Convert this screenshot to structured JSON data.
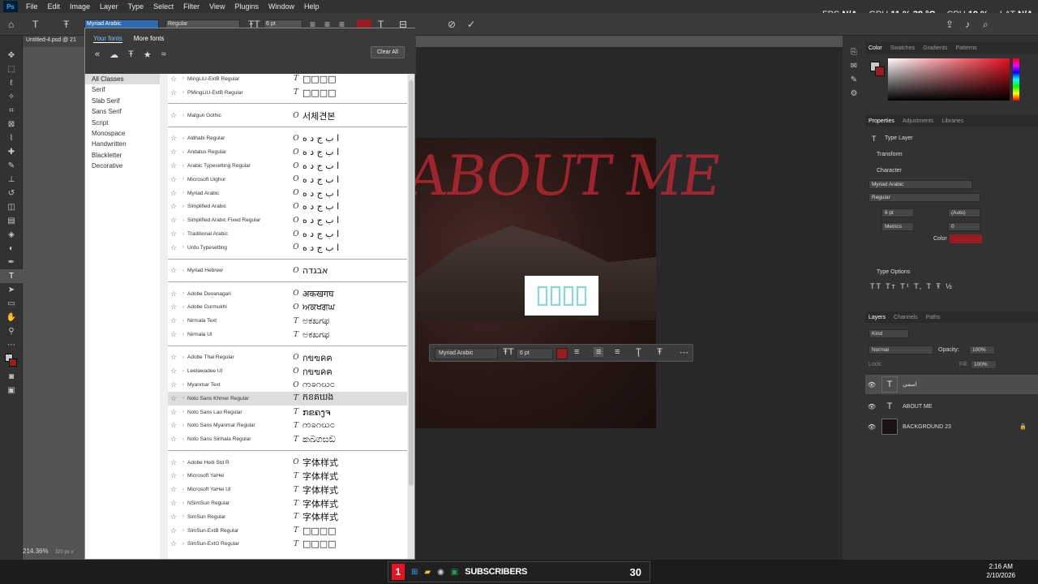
{
  "menu": {
    "items": [
      "File",
      "Edit",
      "Image",
      "Layer",
      "Type",
      "Select",
      "Filter",
      "View",
      "Plugins",
      "Window",
      "Help"
    ]
  },
  "perf": {
    "fps_label": "FPS",
    "fps": "N/A",
    "gpu_label": "GPU",
    "gpu": "11 % 38 °C",
    "cpu_label": "CPU",
    "cpu": "19 %",
    "lat_label": "LAT",
    "lat": "N/A"
  },
  "options": {
    "font": "Myriad Arabic",
    "style": "Regular",
    "size": "6 pt",
    "color": "#971d23"
  },
  "doc_tab": "Untitled-4.psd @ 21",
  "font_panel": {
    "tabs": [
      "Your fonts",
      "More fonts"
    ],
    "clear_all": "Clear All",
    "classes": [
      "All Classes",
      "Serif",
      "Slab Serif",
      "Sans Serif",
      "Script",
      "Monospace",
      "Handwritten",
      "Blackletter",
      "Decorative"
    ],
    "fonts": [
      {
        "name": "MingLiU-ExtB Regular",
        "type": "T",
        "sample": "□□□□"
      },
      {
        "name": "PMingLiU-ExtB Regular",
        "type": "T",
        "sample": "□□□□"
      },
      {
        "name": "Malgun Gothic",
        "type": "O",
        "sample": "서체견본"
      },
      {
        "name": "Aldhabi Regular",
        "type": "O",
        "sample": "ا ب ج د ه"
      },
      {
        "name": "Andalus Regular",
        "type": "O",
        "sample": "ا ب ج د ه"
      },
      {
        "name": "Arabic Typesetting Regular",
        "type": "O",
        "sample": "ا ب ج د ه"
      },
      {
        "name": "Microsoft Uighur",
        "type": "O",
        "sample": "ا ب ج د ه"
      },
      {
        "name": "Myriad Arabic",
        "type": "O",
        "sample": "ا ب ج د ه"
      },
      {
        "name": "Simplified Arabic",
        "type": "O",
        "sample": "ا ب ج د ه"
      },
      {
        "name": "Simplified Arabic Fixed Regular",
        "type": "O",
        "sample": "ا ب ج د ه"
      },
      {
        "name": "Traditional Arabic",
        "type": "O",
        "sample": "ا ب ج د ه"
      },
      {
        "name": "Urdu Typesetting",
        "type": "O",
        "sample": "ا ب ج د ه"
      },
      {
        "name": "Myriad Hebrew",
        "type": "O",
        "sample": "אבגדה"
      },
      {
        "name": "Adobe Devanagari",
        "type": "O",
        "sample": "अकखगघ"
      },
      {
        "name": "Adobe Gurmukhi",
        "type": "O",
        "sample": "ਅਕਖਗਘ"
      },
      {
        "name": "Nirmala Text",
        "type": "T",
        "sample": "ಅಕಖಗಫ"
      },
      {
        "name": "Nirmala UI",
        "type": "T",
        "sample": "ಅಕಖಗಫ"
      },
      {
        "name": "Adobe Thai Regular",
        "type": "O",
        "sample": "กขฃคฅ"
      },
      {
        "name": "Leelawadee UI",
        "type": "O",
        "sample": "กขฃคฅ"
      },
      {
        "name": "Myanmar Text",
        "type": "O",
        "sample": "ကခဂဃင"
      },
      {
        "name": "Noto Sans Khmer Regular",
        "type": "T",
        "sample": "កខគឃង"
      },
      {
        "name": "Noto Sans Lao Regular",
        "type": "T",
        "sample": "ກຂຄງຈ"
      },
      {
        "name": "Noto Sans Myanmar Regular",
        "type": "T",
        "sample": "ကခဂဃင"
      },
      {
        "name": "Noto Sans Sinhala Regular",
        "type": "T",
        "sample": "කඛගඝඞ"
      },
      {
        "name": "Adobe Heiti Std R",
        "type": "O",
        "sample": "字体样式"
      },
      {
        "name": "Microsoft YaHei",
        "type": "T",
        "sample": "字体样式"
      },
      {
        "name": "Microsoft YaHei UI",
        "type": "T",
        "sample": "字体样式"
      },
      {
        "name": "NSimSun Regular",
        "type": "T",
        "sample": "字体样式"
      },
      {
        "name": "SimSun Regular",
        "type": "T",
        "sample": "字体样式"
      },
      {
        "name": "SimSun-ExtB Regular",
        "type": "T",
        "sample": "□□□□"
      },
      {
        "name": "SimSun-ExtG Regular",
        "type": "T",
        "sample": "□□□□"
      }
    ]
  },
  "canvas": {
    "title_text": "ABOUT ME"
  },
  "context_bar": {
    "font": "Myriad Arabic",
    "size": "6 pt"
  },
  "panels": {
    "color_tabs": [
      "Color",
      "Swatches",
      "Gradients",
      "Patterns"
    ],
    "props_tabs": [
      "Properties",
      "Adjustments",
      "Libraries"
    ],
    "type_layer": "Type Layer",
    "transform": "Transform",
    "character": "Character",
    "char_font": "Myriad Arabic",
    "char_style": "Regular",
    "char_size": "6 pt",
    "char_leading": "(Auto)",
    "char_kerning": "Metrics",
    "char_tracking": "0",
    "color_label": "Color",
    "type_options": "Type Options",
    "layers_tabs": [
      "Layers",
      "Channels",
      "Paths"
    ],
    "kind": "Kind",
    "blend": "Normal",
    "opacity_label": "Opacity:",
    "opacity": "100%",
    "lock_label": "Lock:",
    "fill_label": "Fill:",
    "fill": "100%",
    "layers": [
      {
        "name": "اسمي",
        "kind": "T",
        "selected": true
      },
      {
        "name": "ABOUT ME",
        "kind": "T",
        "selected": false
      },
      {
        "name": "BACKGROUND 23",
        "kind": "img",
        "selected": false
      }
    ]
  },
  "status": {
    "zoom": "214.36%",
    "size": "320 px x"
  },
  "taskbar": {
    "badge": "1",
    "label": "SUBSCRIBERS",
    "count": "30",
    "time": "2:16 AM",
    "date": "2/10/2026"
  }
}
